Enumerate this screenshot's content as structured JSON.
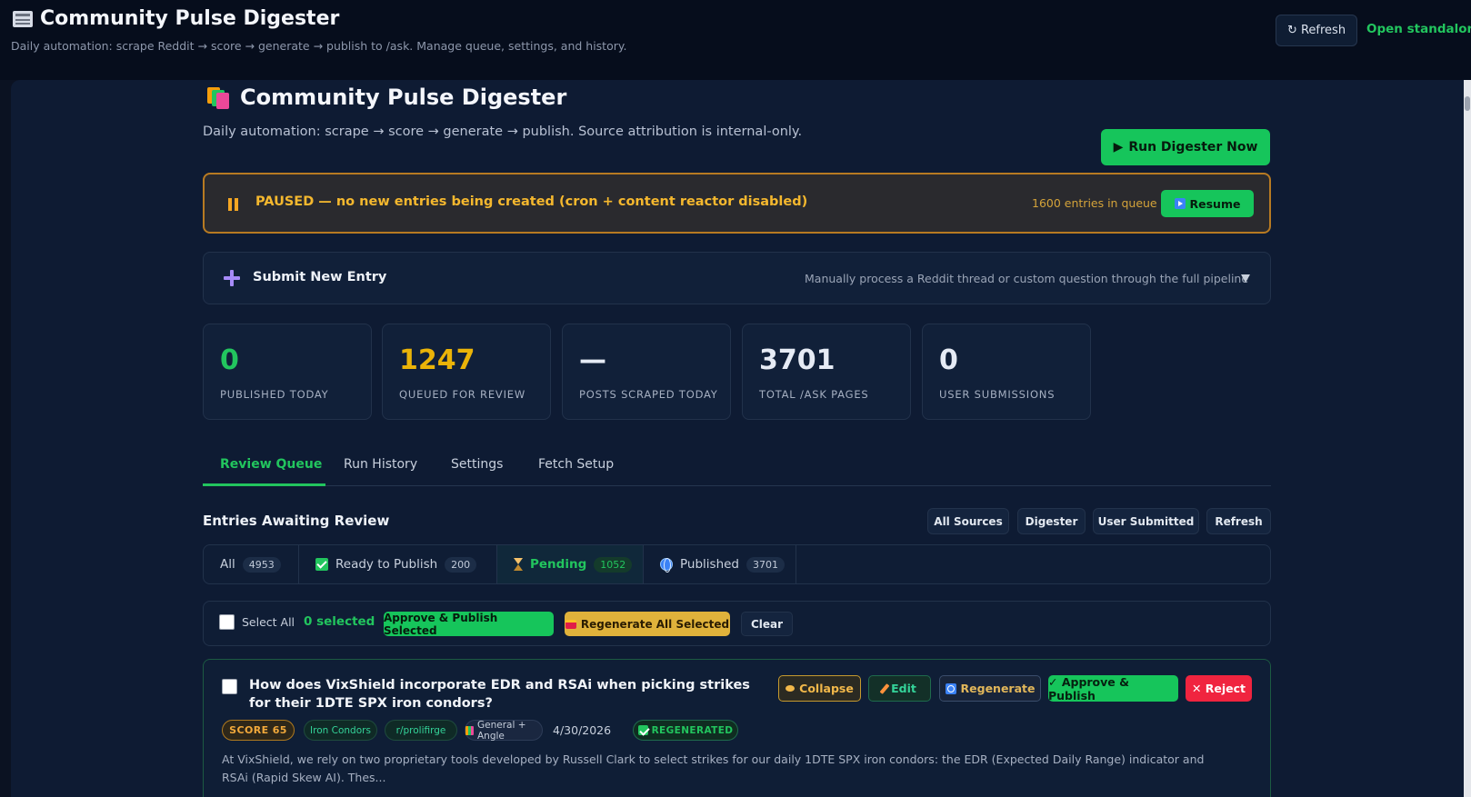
{
  "app": {
    "title": "Community Pulse Digester",
    "subtitle": "Daily automation: scrape Reddit → score → generate → publish to /ask. Manage queue, settings, and history.",
    "refresh_label": "↻ Refresh",
    "standalone_label": "Open standalone ↗"
  },
  "page": {
    "title": "Community Pulse Digester",
    "subtitle": "Daily automation: scrape → score → generate → publish. Source attribution is internal-only.",
    "run_label": "Run Digester Now"
  },
  "paused": {
    "message": "PAUSED — no new entries being created (cron + content reactor disabled)",
    "queue_count": "1600 entries in queue",
    "resume_label": "Resume"
  },
  "submit": {
    "title": "Submit New Entry",
    "hint": "Manually process a Reddit thread or custom question through the full pipeline"
  },
  "stats": [
    {
      "value": "0",
      "label": "PUBLISHED TODAY",
      "color": "#22c55e"
    },
    {
      "value": "1247",
      "label": "QUEUED FOR REVIEW",
      "color": "#eab308"
    },
    {
      "value": "—",
      "label": "POSTS SCRAPED TODAY",
      "color": "#f4f6fb"
    },
    {
      "value": "3701",
      "label": "TOTAL /ASK PAGES",
      "color": "#f4f6fb"
    },
    {
      "value": "0",
      "label": "USER SUBMISSIONS",
      "color": "#f4f6fb"
    }
  ],
  "tabs": [
    "Review Queue",
    "Run History",
    "Settings",
    "Fetch Setup"
  ],
  "entries": {
    "title": "Entries Awaiting Review",
    "sources": [
      "All Sources",
      "Digester",
      "User Submitted",
      "Refresh"
    ]
  },
  "filters": [
    {
      "label": "All",
      "count": "4953"
    },
    {
      "label": "Ready to Publish",
      "count": "200"
    },
    {
      "label": "Pending",
      "count": "1052"
    },
    {
      "label": "Published",
      "count": "3701"
    }
  ],
  "selection": {
    "select_all": "Select All",
    "count": "0 selected",
    "approve_label": "Approve & Publish Selected",
    "regen_label": "Regenerate All Selected",
    "clear_label": "Clear"
  },
  "card": {
    "title": "How does VixShield incorporate EDR and RSAi when picking strikes for their 1DTE SPX iron condors?",
    "collapse": "Collapse",
    "edit": "Edit",
    "regenerate": "Regenerate",
    "approve": "✓ Approve & Publish",
    "reject": "✕ Reject",
    "score": "SCORE 65",
    "tag1": "Iron Condors",
    "tag2": "r/prolifirge",
    "tag3": "General + Angle",
    "date": "4/30/2026",
    "status": "REGENERATED",
    "body": "At VixShield, we rely on two proprietary tools developed by Russell Clark to select strikes for our daily 1DTE SPX iron condors: the EDR (Expected Daily Range) indicator and RSAi (Rapid Skew AI). Thes..."
  }
}
